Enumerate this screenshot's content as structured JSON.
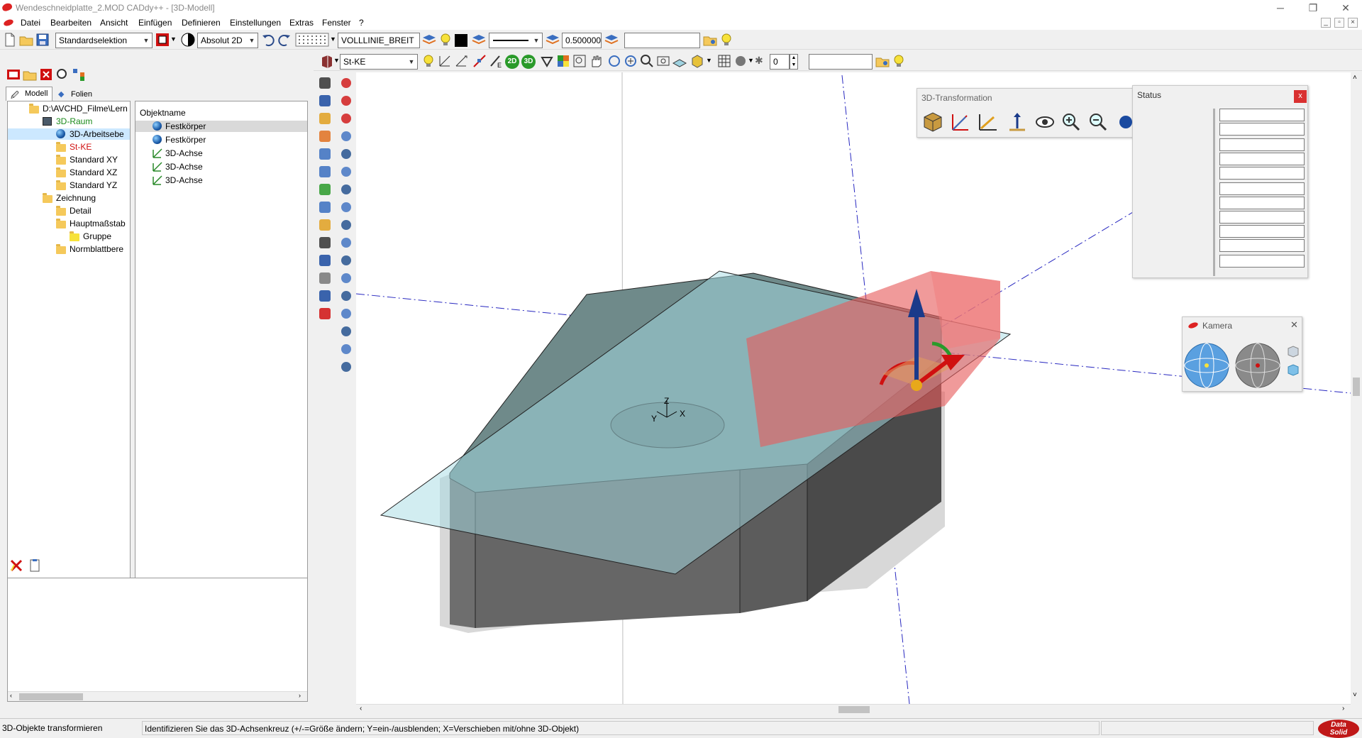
{
  "window": {
    "title": "Wendeschneidplatte_2.MOD    CADdy++ - [3D-Modell]",
    "controls": [
      "─",
      "❐",
      "✕"
    ]
  },
  "menu": {
    "items": [
      "Datei",
      "Bearbeiten",
      "Ansicht",
      "Einfügen",
      "Definieren",
      "Einstellungen",
      "Extras",
      "Fenster",
      "?"
    ]
  },
  "toolbar1": {
    "selection_mode": "Standardselektion",
    "coord_mode": "Absolut 2D",
    "line_type": "VOLLLINIE_BREIT",
    "line_width": "0.500000",
    "empty_field": ""
  },
  "toolbar2": {
    "layer": "St-KE",
    "badge_2d": "2D",
    "badge_3d": "3D",
    "counter": "0",
    "empty_field": ""
  },
  "tabs": [
    {
      "label": "Modell",
      "active": true
    },
    {
      "label": "Folien",
      "active": false
    }
  ],
  "tree": {
    "items": [
      {
        "label": "D:\\AVCHD_Filme\\Lern",
        "indent": 2,
        "icon": "folder-open-icon",
        "color": "#000000"
      },
      {
        "label": "3D-Raum",
        "indent": 3,
        "icon": "cube-icon",
        "color": "#1a8a1a"
      },
      {
        "label": "3D-Arbeitsebe",
        "indent": 4,
        "icon": "sphere-icon",
        "color": "#000000",
        "selected": true
      },
      {
        "label": "St-KE",
        "indent": 4,
        "icon": "folder-icon",
        "color": "#d01010"
      },
      {
        "label": "Standard XY",
        "indent": 4,
        "icon": "folder-icon",
        "color": "#000000"
      },
      {
        "label": "Standard XZ",
        "indent": 4,
        "icon": "folder-icon",
        "color": "#000000"
      },
      {
        "label": "Standard YZ",
        "indent": 4,
        "icon": "folder-icon",
        "color": "#000000"
      },
      {
        "label": "Zeichnung",
        "indent": 3,
        "icon": "folder-open-icon",
        "color": "#000000"
      },
      {
        "label": "Detail",
        "indent": 4,
        "icon": "folder-icon",
        "color": "#000000"
      },
      {
        "label": "Hauptmaßstab",
        "indent": 4,
        "icon": "folder-icon",
        "color": "#000000"
      },
      {
        "label": "Gruppe",
        "indent": 5,
        "icon": "folder-yellow-icon",
        "color": "#000000"
      },
      {
        "label": "Normblattbere",
        "indent": 4,
        "icon": "folder-icon",
        "color": "#000000"
      }
    ]
  },
  "objects": {
    "header": "Objektname",
    "items": [
      {
        "label": "Festkörper",
        "icon": "sphere-icon",
        "selected": true
      },
      {
        "label": "Festkörper",
        "icon": "sphere-icon"
      },
      {
        "label": "3D-Achse",
        "icon": "axis-icon"
      },
      {
        "label": "3D-Achse",
        "icon": "axis-icon"
      },
      {
        "label": "3D-Achse",
        "icon": "axis-icon"
      }
    ]
  },
  "viewport": {
    "axis_labels": {
      "z": "Z",
      "y": "Y",
      "x": "X"
    }
  },
  "panels": {
    "transformation_title": "3D-Transformation",
    "status_title": "Status",
    "status_close": "x",
    "camera_title": "Kamera",
    "camera_close": "✕"
  },
  "statusbar": {
    "mode": "3D-Objekte transformieren",
    "hint": "Identifizieren Sie das 3D-Achsenkreuz (+/-=Größe ändern; Y=ein-/ausblenden; X=Verschieben mit/ohne 3D-Objekt)",
    "logo_line1": "Data",
    "logo_line2": "Solid"
  },
  "colors": {
    "accent_red": "#d01010",
    "tree_green": "#1a8a1a",
    "plane": "#b8e4ea",
    "solid_top": "#6f8c8c",
    "solid_side": "#5a5a5a",
    "tool_red": "#e06060"
  }
}
